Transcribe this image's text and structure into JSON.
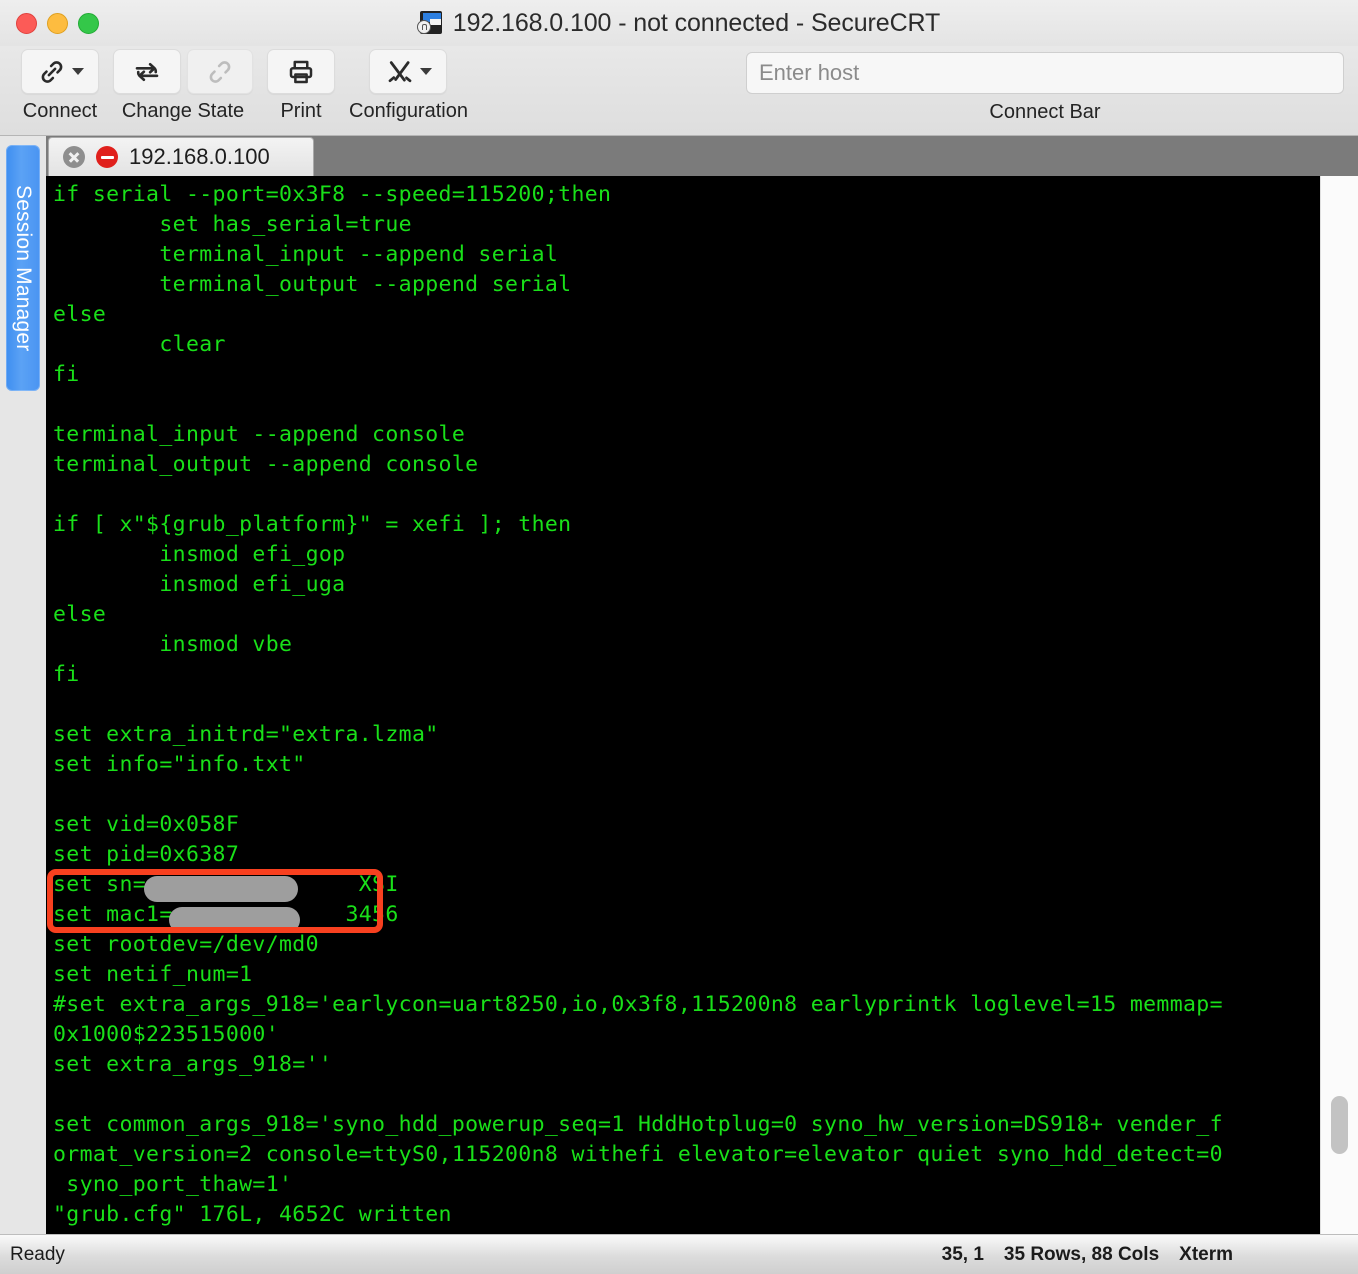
{
  "window": {
    "title": "192.168.0.100 - not connected - SecureCRT",
    "traffic_lights": [
      "close",
      "minimize",
      "zoom"
    ]
  },
  "toolbar": {
    "items": [
      {
        "label": "Connect",
        "icon": "link-icon",
        "has_chevron": true
      },
      {
        "label": "Change State",
        "icon": "reconnect-icon",
        "icon2": "disconnect-icon",
        "has_chevron": false
      },
      {
        "label": "Print",
        "icon": "printer-icon",
        "has_chevron": false
      },
      {
        "label": "Configuration",
        "icon": "tools-icon",
        "has_chevron": true
      }
    ],
    "connect_bar": {
      "placeholder": "Enter host",
      "value": "",
      "label": "Connect Bar"
    }
  },
  "sidebar": {
    "session_manager_label": "Session Manager"
  },
  "tabs": [
    {
      "title": "192.168.0.100",
      "close_icon": "close-icon",
      "status_icon": "disconnected-icon",
      "active": true
    }
  ],
  "terminal": {
    "colors": {
      "foreground": "#19e019",
      "background": "#000000"
    },
    "lines": [
      "if serial --port=0x3F8 --speed=115200;then",
      "        set has_serial=true",
      "        terminal_input --append serial",
      "        terminal_output --append serial",
      "else",
      "        clear",
      "fi",
      "",
      "terminal_input --append console",
      "terminal_output --append console",
      "",
      "if [ x\"${grub_platform}\" = xefi ]; then",
      "        insmod efi_gop",
      "        insmod efi_uga",
      "else",
      "        insmod vbe",
      "fi",
      "",
      "set extra_initrd=\"extra.lzma\"",
      "set info=\"info.txt\"",
      "",
      "set vid=0x058F",
      "set pid=0x6387",
      "set sn=                XSI",
      "set mac1=             3456",
      "set rootdev=/dev/md0",
      "set netif_num=1",
      "#set extra_args_918='earlycon=uart8250,io,0x3f8,115200n8 earlyprintk loglevel=15 memmap=",
      "0x1000$223515000'",
      "set extra_args_918=''",
      "",
      "set common_args_918='syno_hdd_powerup_seq=1 HddHotplug=0 syno_hw_version=DS918+ vender_f",
      "ormat_version=2 console=ttyS0,115200n8 withefi elevator=elevator quiet syno_hdd_detect=0",
      " syno_port_thaw=1'",
      "\"grub.cfg\" 176L, 4652C written"
    ],
    "redactions": [
      {
        "line": "set sn=",
        "note": "serial-number-redacted"
      },
      {
        "line": "set mac1=",
        "note": "mac-address-redacted"
      }
    ],
    "highlight": {
      "color": "#f8401f",
      "covers": [
        "set sn=",
        "set mac1="
      ]
    }
  },
  "statusbar": {
    "ready": "Ready",
    "cursor": "35, 1",
    "dimensions": "35 Rows, 88 Cols",
    "emulation": "Xterm"
  }
}
